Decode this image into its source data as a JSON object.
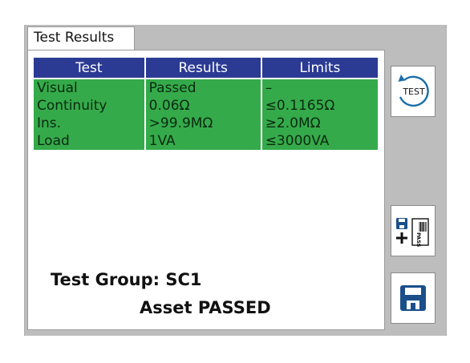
{
  "tab": {
    "label": "Test Results"
  },
  "table": {
    "headers": [
      "Test",
      "Results",
      "Limits"
    ],
    "rows": [
      {
        "test": "Visual",
        "result": "Passed",
        "limit": "–"
      },
      {
        "test": "Continuity",
        "result": "0.06Ω",
        "limit": "≤0.1165Ω"
      },
      {
        "test": "Ins.",
        "result": ">99.9MΩ",
        "limit": "≥2.0MΩ"
      },
      {
        "test": "Load",
        "result": "1VA",
        "limit": "≤3000VA"
      }
    ]
  },
  "summary": {
    "group": "Test Group: SC1",
    "status": "Asset PASSED"
  },
  "buttons": {
    "test_icon_label": "TEST",
    "pass_icon_label": "PASS",
    "test_icon": "retest-icon",
    "save_pass_icon": "save-and-print-pass-label-icon",
    "save_icon": "floppy-disk-icon"
  },
  "colors": {
    "header_bg": "#2b3b94",
    "row_bg": "#35aa4a",
    "panel_bg": "#bdbdbd"
  }
}
